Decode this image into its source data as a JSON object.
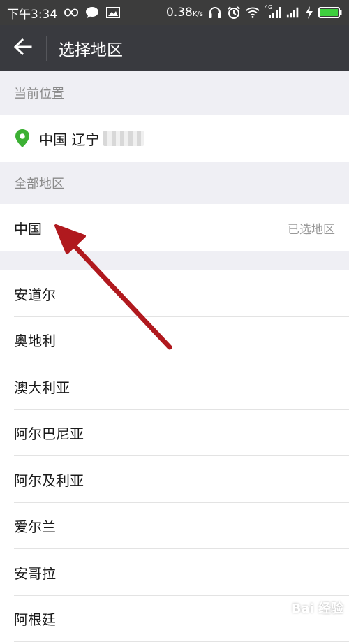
{
  "status_bar": {
    "time": "下午3:34",
    "speed": "0.38",
    "speed_unit": "K/s",
    "network": "4G",
    "icons": [
      "infinity-icon",
      "chat-icon",
      "image-icon",
      "headphones-icon",
      "alarm-icon",
      "wifi-icon",
      "signal-icon",
      "signal-icon",
      "charging-icon",
      "battery-icon"
    ]
  },
  "nav": {
    "back_icon": "back-arrow-icon",
    "title": "选择地区"
  },
  "current_location": {
    "header": "当前位置",
    "icon": "location-pin-icon",
    "text": "中国 辽宁"
  },
  "all_regions": {
    "header": "全部地区",
    "selected_region": "中国",
    "selected_tag": "已选地区"
  },
  "regions": [
    "安道尔",
    "奥地利",
    "澳大利亚",
    "阿尔巴尼亚",
    "阿尔及利亚",
    "爱尔兰",
    "安哥拉",
    "阿根廷"
  ],
  "watermark": "Bai 经验",
  "colors": {
    "statusbar_bg": "#3c3c3c",
    "navbar_bg": "#393a3f",
    "page_bg": "#efeff4",
    "pin_green": "#3cb034",
    "annotation_arrow": "#b0191e"
  }
}
